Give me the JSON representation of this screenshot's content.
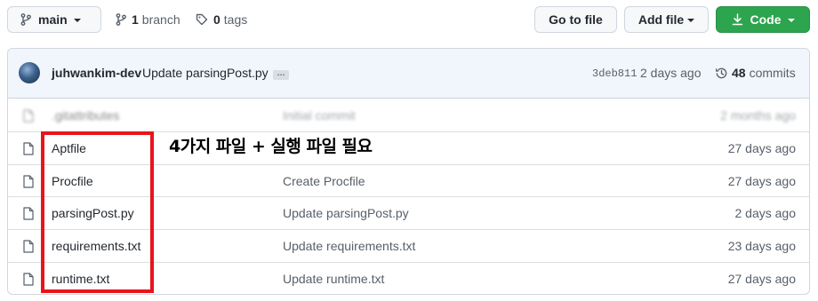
{
  "toolbar": {
    "branch_name": "main",
    "branch_count": "1",
    "branch_label": "branch",
    "tag_count": "0",
    "tag_label": "tags",
    "go_to_file": "Go to file",
    "add_file": "Add file",
    "code": "Code"
  },
  "latest_commit": {
    "author": "juhwankim-dev",
    "message": "Update parsingPost.py",
    "ellipsis": "…",
    "sha": "3deb811",
    "date": "2 days ago",
    "commit_count": "48",
    "commit_label": "commits"
  },
  "files": [
    {
      "name": ".gitattributes",
      "message": "Initial commit",
      "date": "2 months ago",
      "blurred": true
    },
    {
      "name": "Aptfile",
      "message": "",
      "date": "27 days ago"
    },
    {
      "name": "Procfile",
      "message": "Create Procfile",
      "date": "27 days ago"
    },
    {
      "name": "parsingPost.py",
      "message": "Update parsingPost.py",
      "date": "2 days ago"
    },
    {
      "name": "requirements.txt",
      "message": "Update requirements.txt",
      "date": "23 days ago"
    },
    {
      "name": "runtime.txt",
      "message": "Update runtime.txt",
      "date": "27 days ago"
    }
  ],
  "annotation": {
    "text": "4가지 파일 + 실행 파일 필요",
    "color": "#e8141c"
  },
  "colors": {
    "code_button": "#2da44e",
    "header_bg": "#f0f6fc"
  }
}
